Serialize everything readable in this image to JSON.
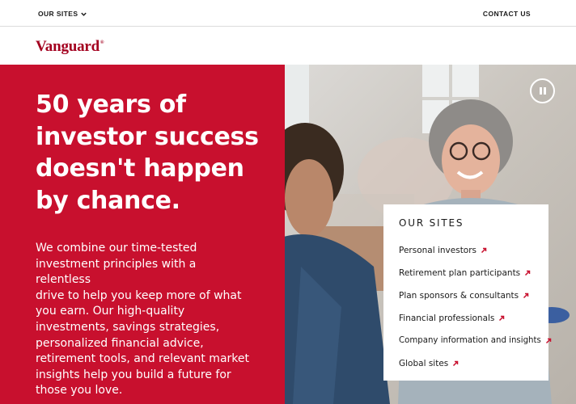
{
  "utility_bar": {
    "our_sites_label": "OUR SITES",
    "contact_label": "CONTACT US"
  },
  "header": {
    "logo_text": "Vanguard",
    "logo_mark": "®"
  },
  "hero": {
    "title_lines": [
      "50 years of",
      "investor success",
      "doesn't happen",
      "by chance."
    ],
    "body_lines": [
      "We combine our time-tested",
      "investment principles with a relentless",
      "drive to help you keep more of what",
      "you earn. Our high-quality",
      "investments, savings strategies,",
      "personalized financial advice,",
      "retirement tools, and relevant market",
      "insights help you build a future for",
      "those you love."
    ]
  },
  "sites_card": {
    "title": "OUR SITES",
    "links": [
      "Personal investors",
      "Retirement plan participants",
      "Plan sponsors & consultants",
      "Financial professionals",
      "Company information and insights",
      "Global sites"
    ]
  },
  "colors": {
    "brand_red": "#c8102e",
    "logo_red": "#a3001f",
    "arrow_red": "#c8102e"
  },
  "icons": {
    "dropdown": "chevron-down-icon",
    "pause": "pause-icon",
    "external": "arrow-up-right-icon"
  }
}
